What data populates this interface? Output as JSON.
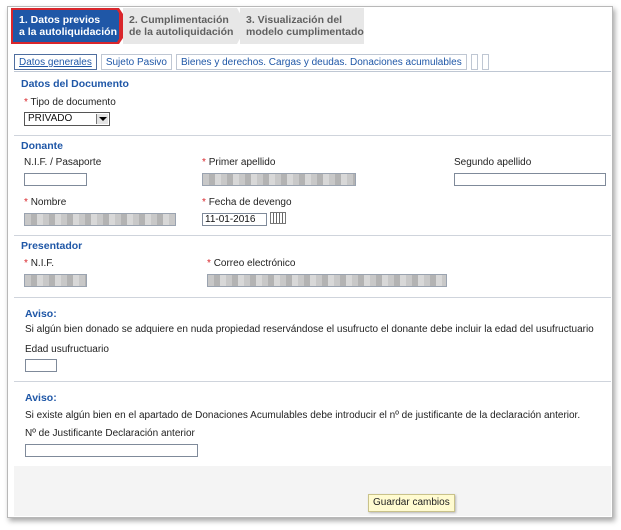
{
  "steps": [
    {
      "line1": "1. Datos previos",
      "line2": "a la autoliquidación"
    },
    {
      "line1": "2. Cumplimentación",
      "line2": "de la autoliquidación"
    },
    {
      "line1": "3. Visualización del",
      "line2": "modelo cumplimentado"
    }
  ],
  "tabs": [
    "Datos generales",
    "Sujeto Pasivo",
    "Bienes y derechos. Cargas y deudas. Donaciones acumulables"
  ],
  "documento": {
    "title": "Datos del Documento",
    "tipo_label": "Tipo de documento",
    "tipo_value": "PRIVADO"
  },
  "donante": {
    "title": "Donante",
    "nif_label": "N.I.F. / Pasaporte",
    "apellido1_label": "Primer apellido",
    "apellido2_label": "Segundo apellido",
    "nombre_label": "Nombre",
    "fecha_label": "Fecha de devengo",
    "fecha_value": "11-01-2016"
  },
  "presentador": {
    "title": "Presentador",
    "nif_label": "N.I.F.",
    "correo_label": "Correo electrónico"
  },
  "aviso1": {
    "title": "Aviso:",
    "text": "Si algún bien donado se adquiere en nuda propiedad reservándose el usufructo el donante debe incluir la edad del usufructuario",
    "field_label": "Edad usufructuario"
  },
  "aviso2": {
    "title": "Aviso:",
    "text": "Si existe algún bien en el apartado de Donaciones Acumulables debe introducir el nº de justificante de la declaración anterior.",
    "field_label": "Nº de Justificante Declaración anterior"
  },
  "required_mark": "*",
  "save_label": "Guardar cambios"
}
